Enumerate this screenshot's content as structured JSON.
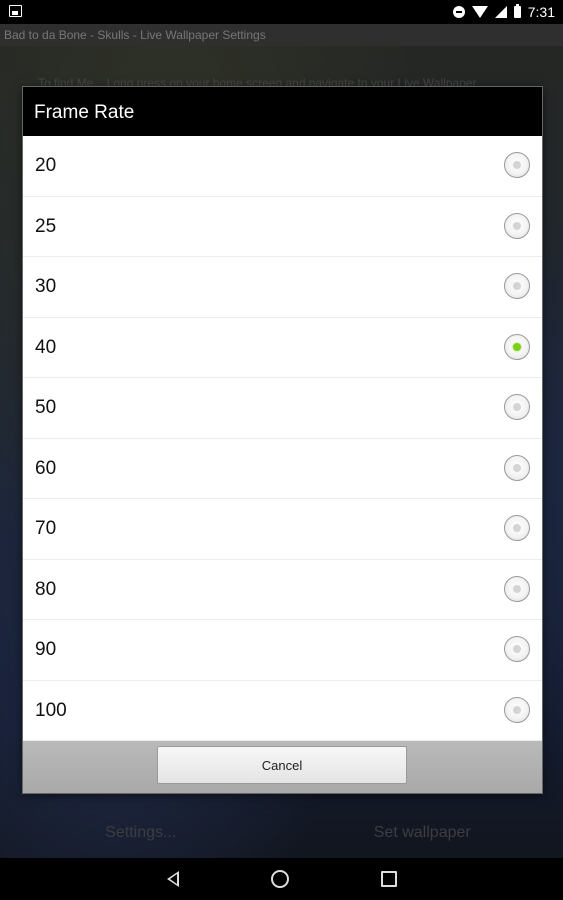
{
  "status_bar": {
    "time": "7:31"
  },
  "app_title": "Bad to da Bone - Skulls - Live Wallpaper Settings",
  "background_hint": "To find Me... Long press on your home screen and navigate to your Live Wallpaper",
  "background_buttons": {
    "settings": "Settings...",
    "set_wallpaper": "Set wallpaper"
  },
  "dialog": {
    "title": "Frame Rate",
    "options": [
      {
        "label": "20",
        "selected": false
      },
      {
        "label": "25",
        "selected": false
      },
      {
        "label": "30",
        "selected": false
      },
      {
        "label": "40",
        "selected": true
      },
      {
        "label": "50",
        "selected": false
      },
      {
        "label": "60",
        "selected": false
      },
      {
        "label": "70",
        "selected": false
      },
      {
        "label": "80",
        "selected": false
      },
      {
        "label": "90",
        "selected": false
      },
      {
        "label": "100",
        "selected": false
      }
    ],
    "cancel_label": "Cancel"
  },
  "colors": {
    "selected_radio": "#7ccf1a",
    "header_bg": "#000000"
  },
  "icons": [
    "image-notification-icon",
    "do-not-disturb-icon",
    "wifi-icon",
    "signal-icon",
    "battery-icon",
    "back-icon",
    "home-icon",
    "recent-apps-icon"
  ]
}
